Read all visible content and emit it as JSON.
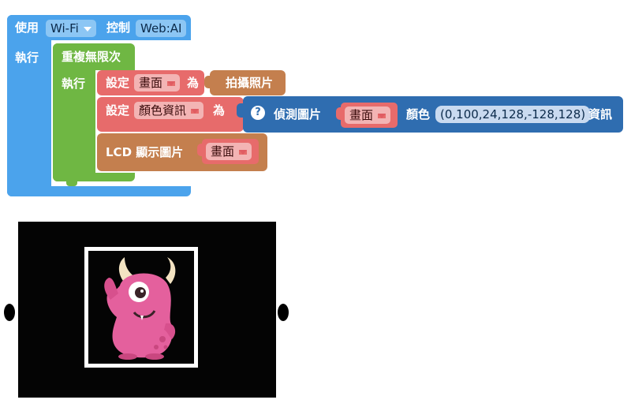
{
  "block_use": {
    "use_label": "使用",
    "wifi_value": "Wi-Fi",
    "control_label": "控制",
    "device_value": "Web:AI",
    "exec_label": "執行"
  },
  "block_repeat": {
    "repeat_label": "重複無限次",
    "exec_label": "執行"
  },
  "block_set_canvas": {
    "set_label": "設定",
    "var_value": "畫面",
    "as_label": "為",
    "value_label": "拍攝照片"
  },
  "block_set_color": {
    "set_label": "設定",
    "var_value": "顏色資訊",
    "as_label": "為"
  },
  "block_detect": {
    "help_symbol": "?",
    "detect_label": "偵測圖片",
    "image_value": "畫面",
    "color_label": "顏色",
    "range_value": "(0,100,24,128,-128,128)",
    "info_label": "資訊"
  },
  "block_lcd": {
    "lcd_label": "LCD 顯示圖片",
    "image_value": "畫面"
  },
  "colors": {
    "blue": "#4ba3ec",
    "green": "#6fb743",
    "red": "#e76b6b",
    "brown": "#c47f4e",
    "dark_blue": "#2f6db0",
    "monster_pink": "#e4609d",
    "canvas_bg": "#040404"
  },
  "preview": {
    "icon": "pink-one-eyed-monster-illustration"
  }
}
